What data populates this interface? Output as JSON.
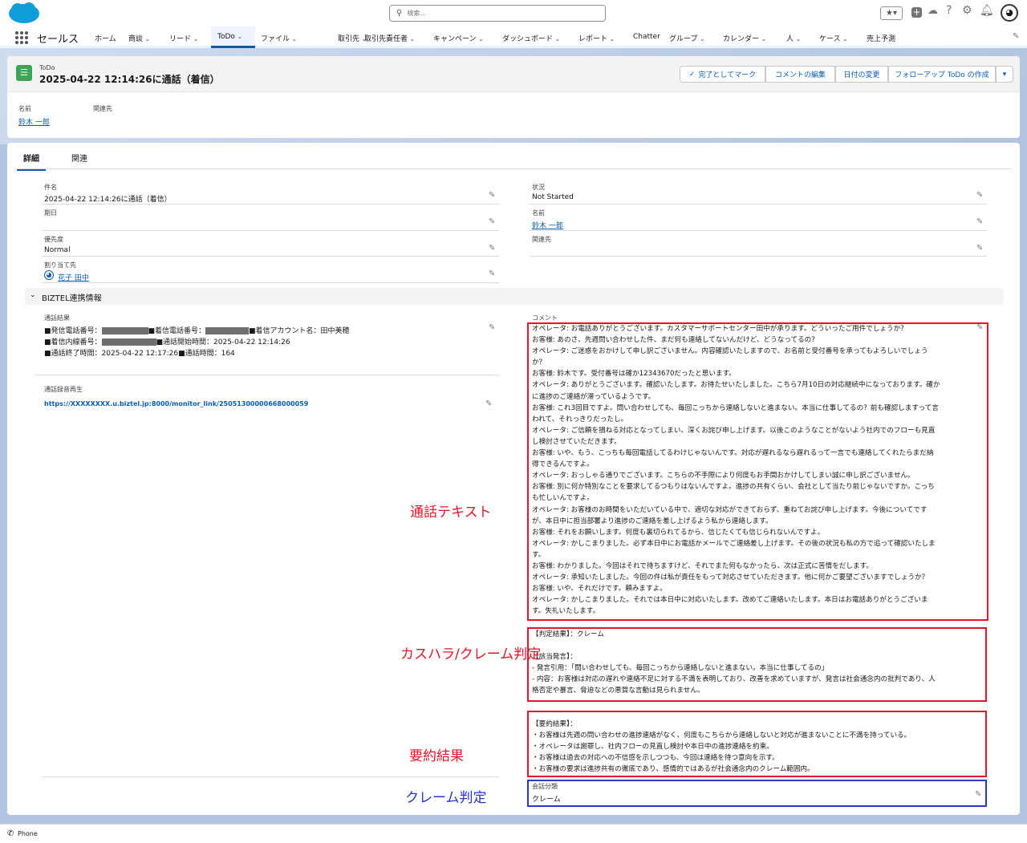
{
  "header": {
    "search_placeholder": "検索...",
    "app_name": "セールス"
  },
  "nav": {
    "items": [
      {
        "label": "ホーム",
        "chev": false
      },
      {
        "label": "商談",
        "chev": true
      },
      {
        "label": "リード",
        "chev": true
      },
      {
        "label": "ToDo",
        "chev": true,
        "active": true
      },
      {
        "label": "ファイル",
        "chev": true
      },
      {
        "label": "取引先",
        "chev": true
      },
      {
        "label": "取引先責任者",
        "chev": true
      },
      {
        "label": "キャンペーン",
        "chev": true
      },
      {
        "label": "ダッシュボード",
        "chev": true
      },
      {
        "label": "レポート",
        "chev": true
      },
      {
        "label": "Chatter",
        "chev": false
      },
      {
        "label": "グループ",
        "chev": true
      },
      {
        "label": "カレンダー",
        "chev": true
      },
      {
        "label": "人",
        "chev": true
      },
      {
        "label": "ケース",
        "chev": true
      },
      {
        "label": "売上予測",
        "chev": false
      }
    ]
  },
  "record": {
    "object_type": "ToDo",
    "title": "2025-04-22 12:14:26に通話（着信）",
    "actions": {
      "mark_complete": "完了としてマーク",
      "edit_comment": "コメントの編集",
      "change_date": "日付の変更",
      "follow_up": "フォローアップ ToDo の作成"
    },
    "highlights": {
      "name_label": "名前",
      "name_value": "鈴木 一郎",
      "related_label": "関連先"
    }
  },
  "tabs": {
    "detail": "詳細",
    "related": "関連"
  },
  "fields": {
    "subject_label": "件名",
    "subject_value": "2025-04-22 12:14:26に通話（着信）",
    "status_label": "状況",
    "status_value": "Not Started",
    "due_label": "期日",
    "name_label": "名前",
    "name_value": "鈴木 一郎",
    "priority_label": "優先度",
    "priority_value": "Normal",
    "related_label": "関連先",
    "assigned_label": "割り当て先",
    "assigned_value": "花子 田中"
  },
  "section": {
    "title": "BIZTEL連携情報",
    "call_result_label": "通話結果",
    "call_result_lines": [
      "■発信電話番号：",
      "■着信電話番号：",
      "■着信アカウント名：田中美穂",
      "■着信内線番号：",
      "■通話開始時間：2025-04-22 12:14:26",
      "■通話終了時間：2025-04-22 12:17:26",
      "■通話時間：164"
    ],
    "recording_label": "通話録音再生",
    "recording_url": "https://XXXXXXXX.u.biztel.jp:8000/monitor_link/25051300000668000059",
    "comment_label": "コメント",
    "transcript": [
      "オペレータ: お電話ありがとうございます。カスタマーサポートセンター田中が承ります。どういったご用件でしょうか？",
      "お客様: あのさ、先週問い合わせした件、まだ何も連絡してないんだけど、どうなってるの？",
      "オペレータ: ご迷惑をおかけして申し訳ございません。内容確認いたしますので、お名前と受付番号を承ってもよろしいでしょう",
      "か？",
      "お客様: 鈴木です。受付番号は確か12343670だったと思います。",
      "オペレータ: ありがとうございます。確認いたします。お待たせいたしました。こちら7月10日の対応継続中になっております。確か",
      "に進捗のご連絡が滞っているようです。",
      "お客様: これ3回目ですよ。問い合わせしても、毎回こっちから連絡しないと進まない。本当に仕事してるの？前も確認しますって言",
      "われて、それっきりだったし。",
      "オペレータ: ご信頼を損ねる対応となってしまい、深くお詫び申し上げます。以後このようなことがないよう社内でのフローも見直",
      "し検討させていただきます。",
      "お客様: いや、もう、こっちも毎回電話してるわけじゃないんです。対応が遅れるなら遅れるって一言でも連絡してくれたらまだ納",
      "得できるんですよ。",
      "オペレータ: おっしゃる通りでございます。こちらの不手際により何度もお手間おかけしてしまい誠に申し訳ございません。",
      "お客様: 別に何か特別なことを要求してるつもりはないんですよ。進捗の共有くらい、会社として当たり前じゃないですか。こっち",
      "も忙しいんですよ。",
      "オペレータ: お客様のお時間をいただいている中で、適切な対応ができておらず、重ねてお詫び申し上げます。今後についてです",
      "が、本日中に担当部署より進捗のご連絡を差し上げるよう私から連絡します。",
      "お客様: それをお願いします。何度も裏切られてるから、信じたくても信じられないんですよ。",
      "オペレータ: かしこまりました。必ず本日中にお電話かメールでご連絡差し上げます。その後の状況も私の方で追って確認いたしま",
      "す。",
      "お客様: わかりました。今回はそれで待ちますけど、それでまた何もなかったら、次は正式に苦情をだします。",
      "オペレータ: 承知いたしました。今回の件は私が責任をもって対応させていただきます。他に何かご要望ございますでしょうか？",
      "お客様: いや、それだけです。頼みますよ。",
      "オペレータ: かしこまりました。それでは本日中に対応いたします。改めてご連絡いたします。本日はお電話ありがとうございま",
      "す。失礼いたします。"
    ],
    "judgment": [
      "【判定結果】：クレーム",
      "",
      "【該当発言】：",
      "- 発言引用：「問い合わせしても、毎回こっちから連絡しないと進まない。本当に仕事してるの」",
      "- 内容：お客様は対応の遅れや連絡不足に対する不満を表明しており、改善を求めていますが、発言は社会通念内の批判であり、人",
      "格否定や暴言、脅迫などの悪質な言動は見られません。"
    ],
    "summary": [
      "【要約結果】：",
      "・お客様は先週の問い合わせの進捗連絡がなく、何度もこちらから連絡しないと対応が進まないことに不満を持っている。",
      "・オペレータは謝罪し、社内フローの見直し検討や本日中の進捗連絡を約束。",
      "・お客様は過去の対応への不信感を示しつつも、今回は連絡を待つ意向を示す。",
      "・お客様の要求は進捗共有の徹底であり、感情的ではあるが社会通念内のクレーム範囲内。"
    ],
    "classification_label": "会話分類",
    "classification_value": "クレーム"
  },
  "annotations": {
    "transcript": "通話テキスト",
    "judgment": "カスハラ/クレーム判定",
    "summary": "要約結果",
    "claim": "クレーム判定"
  },
  "footer": {
    "phone": "Phone"
  },
  "colors": {
    "brand": "#0b5cab",
    "red_box": "#e0162b",
    "blue_box": "#2c36c2",
    "todo_icon": "#3ba755"
  }
}
